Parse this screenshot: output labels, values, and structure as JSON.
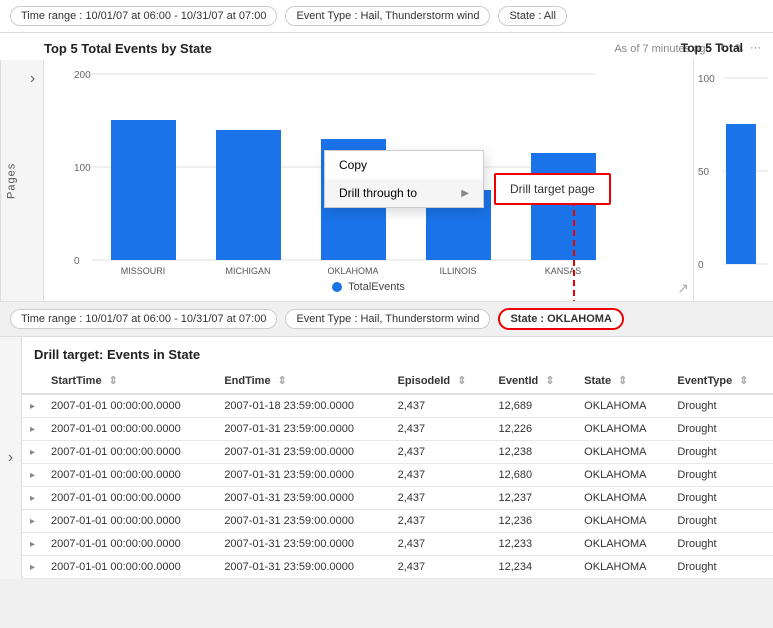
{
  "topFilterBar": {
    "pills": [
      "Time range : 10/01/07 at 06:00 - 10/31/07 at 07:00",
      "Event Type : Hail, Thunderstorm wind",
      "State : All"
    ]
  },
  "chartSection": {
    "title": "Top 5 Total Events by State",
    "meta": "As of 7 minutes ago",
    "pagesLabel": "Pages",
    "legendLabel": "TotalEvents",
    "yMax": 200,
    "yMid": 100,
    "yMin": 0,
    "bars": [
      {
        "label": "MISSOURI",
        "value": 150
      },
      {
        "label": "MICHIGAN",
        "value": 140
      },
      {
        "label": "OKLAHOMA",
        "value": 130
      },
      {
        "label": "ILLINOIS",
        "value": 75
      },
      {
        "label": "KANSAS",
        "value": 115
      }
    ],
    "rightChartTitle": "Top 5 Total",
    "rightYMax": 100,
    "rightY50": 50,
    "rightY0": 0
  },
  "contextMenu": {
    "items": [
      "Copy",
      "Drill through to"
    ],
    "copyLabel": "Copy",
    "drillLabel": "Drill through to",
    "drillTargetLabel": "Drill target page"
  },
  "bottomFilterBar": {
    "pills": [
      "Time range : 10/01/07 at 06:00 - 10/31/07 at 07:00",
      "Event Type : Hail, Thunderstorm wind"
    ],
    "highlightPill": "State : OKLAHOMA"
  },
  "drillTable": {
    "title": "Drill target: Events in State",
    "columns": [
      "StartTime",
      "EndTime",
      "EpisodeId",
      "EventId",
      "State",
      "EventType"
    ],
    "rows": [
      {
        "start": "2007-01-01 00:00:00.0000",
        "end": "2007-01-18 23:59:00.0000",
        "episodeId": "2,437",
        "eventId": "12,689",
        "state": "OKLAHOMA",
        "eventType": "Drought"
      },
      {
        "start": "2007-01-01 00:00:00.0000",
        "end": "2007-01-31 23:59:00.0000",
        "episodeId": "2,437",
        "eventId": "12,226",
        "state": "OKLAHOMA",
        "eventType": "Drought"
      },
      {
        "start": "2007-01-01 00:00:00.0000",
        "end": "2007-01-31 23:59:00.0000",
        "episodeId": "2,437",
        "eventId": "12,238",
        "state": "OKLAHOMA",
        "eventType": "Drought"
      },
      {
        "start": "2007-01-01 00:00:00.0000",
        "end": "2007-01-31 23:59:00.0000",
        "episodeId": "2,437",
        "eventId": "12,680",
        "state": "OKLAHOMA",
        "eventType": "Drought"
      },
      {
        "start": "2007-01-01 00:00:00.0000",
        "end": "2007-01-31 23:59:00.0000",
        "episodeId": "2,437",
        "eventId": "12,237",
        "state": "OKLAHOMA",
        "eventType": "Drought"
      },
      {
        "start": "2007-01-01 00:00:00.0000",
        "end": "2007-01-31 23:59:00.0000",
        "episodeId": "2,437",
        "eventId": "12,236",
        "state": "OKLAHOMA",
        "eventType": "Drought"
      },
      {
        "start": "2007-01-01 00:00:00.0000",
        "end": "2007-01-31 23:59:00.0000",
        "episodeId": "2,437",
        "eventId": "12,233",
        "state": "OKLAHOMA",
        "eventType": "Drought"
      },
      {
        "start": "2007-01-01 00:00:00.0000",
        "end": "2007-01-31 23:59:00.0000",
        "episodeId": "2,437",
        "eventId": "12,234",
        "state": "OKLAHOMA",
        "eventType": "Drought"
      }
    ]
  }
}
